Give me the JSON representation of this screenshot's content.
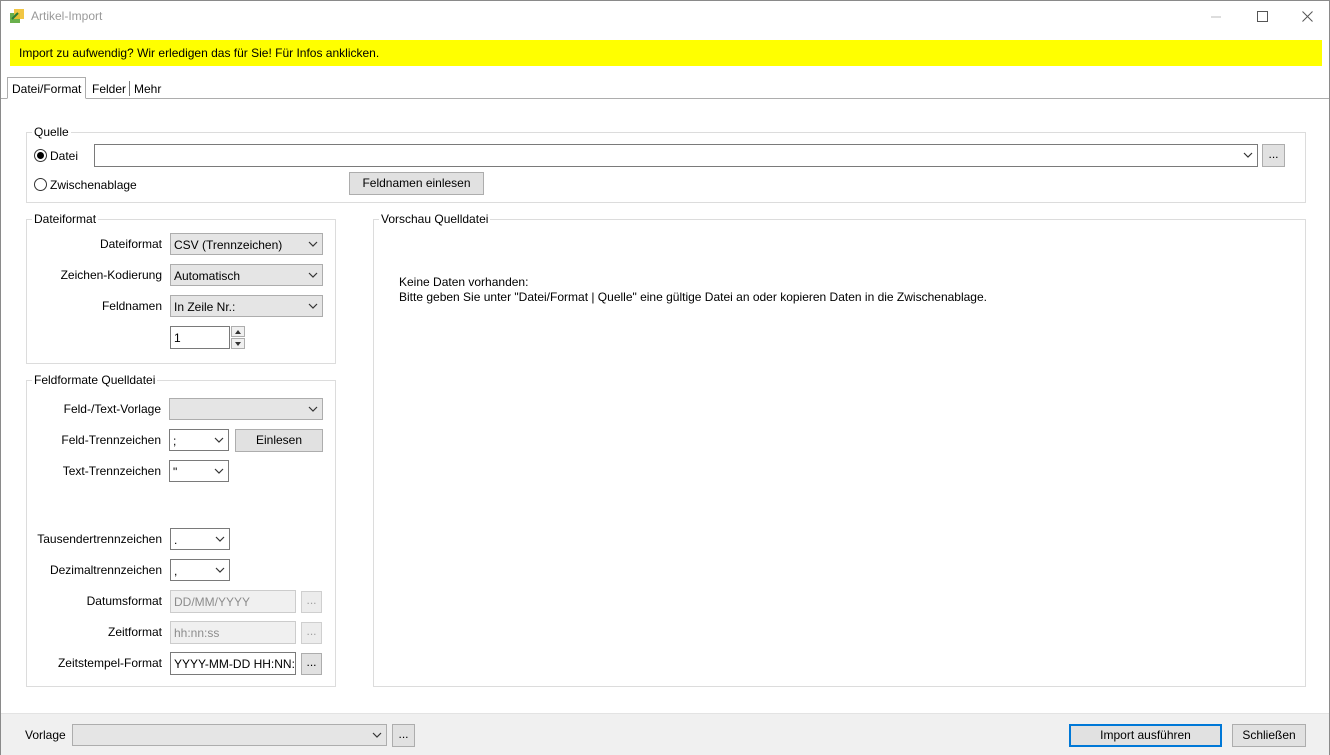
{
  "window": {
    "title": "Artikel-Import",
    "icon": "app-import-icon",
    "controls": {
      "minimize": "minimize-icon",
      "maximize": "maximize-icon",
      "close": "close-icon"
    }
  },
  "banner": {
    "text": "Import zu aufwendig? Wir erledigen das für Sie! Für Infos anklicken.",
    "color": "#ffff00"
  },
  "tabs": [
    {
      "label": "Datei/Format",
      "active": true
    },
    {
      "label": "Felder",
      "active": false
    },
    {
      "label": "Mehr",
      "active": false
    }
  ],
  "quelle": {
    "title": "Quelle",
    "radio_datei": "Datei",
    "radio_zwischenablage": "Zwischenablage",
    "datei_value": "",
    "browse_label": "...",
    "feldnamen_button": "Feldnamen einlesen"
  },
  "dateiformat": {
    "title": "Dateiformat",
    "dateiformat_label": "Dateiformat",
    "dateiformat_value": "CSV (Trennzeichen)",
    "kodierung_label": "Zeichen-Kodierung",
    "kodierung_value": "Automatisch",
    "feldnamen_label": "Feldnamen",
    "feldnamen_value": "In Zeile Nr.:",
    "zeile_nr": "1"
  },
  "feldformate": {
    "title": "Feldformate Quelldatei",
    "vorlage_label": "Feld-/Text-Vorlage",
    "vorlage_value": "",
    "feld_trenn_label": "Feld-Trennzeichen",
    "feld_trenn_value": ";",
    "einlesen_button": "Einlesen",
    "text_trenn_label": "Text-Trennzeichen",
    "text_trenn_value": "\"",
    "tausender_label": "Tausendertrennzeichen",
    "tausender_value": ".",
    "dezimal_label": "Dezimaltrennzeichen",
    "dezimal_value": ",",
    "datum_label": "Datumsformat",
    "datum_value": "DD/MM/YYYY",
    "zeit_label": "Zeitformat",
    "zeit_value": "hh:nn:ss",
    "zeitstempel_label": "Zeitstempel-Format",
    "zeitstempel_value": "YYYY-MM-DD HH:NN:",
    "browse_label": "..."
  },
  "vorschau": {
    "title": "Vorschau Quelldatei",
    "line1": "Keine Daten vorhanden:",
    "line2": "Bitte geben Sie unter \"Datei/Format | Quelle\" eine gültige Datei an oder kopieren Daten in die Zwischenablage."
  },
  "footer": {
    "vorlage_label": "Vorlage",
    "vorlage_value": "",
    "browse_label": "...",
    "import_button": "Import ausführen",
    "close_button": "Schließen"
  }
}
